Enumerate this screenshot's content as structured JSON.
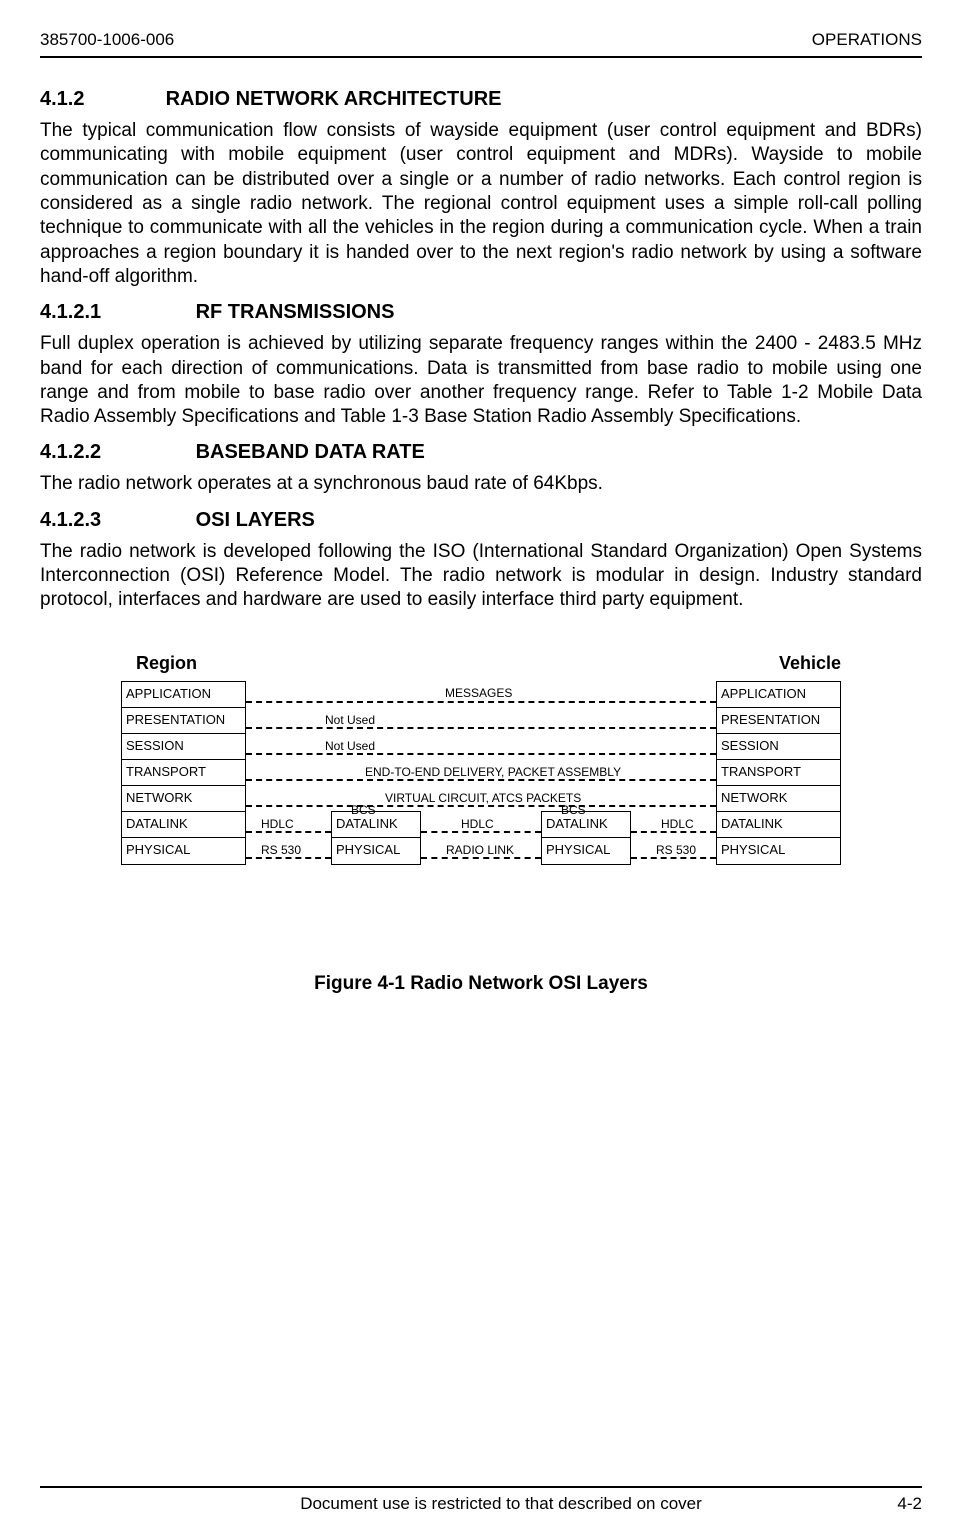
{
  "header": {
    "left": "385700-1006-006",
    "right": "OPERATIONS"
  },
  "sections": {
    "s412": {
      "num": "4.1.2",
      "title": "RADIO NETWORK ARCHITECTURE",
      "para": "The typical communication flow consists of wayside equipment (user  control equipment and BDRs) communicating with mobile equipment  (user control equipment and MDRs).  Wayside to mobile communication can be distributed over a single or a number of radio networks. Each control region is considered as a single radio network. The regional control equipment uses a simple roll-call polling technique to communicate with all the vehicles in the region during a communication cycle. When a train approaches a region boundary it is handed over to the next region's radio network by using a software hand-off algorithm."
    },
    "s4121": {
      "num": "4.1.2.1",
      "title": "RF TRANSMISSIONS",
      "para": "Full duplex operation is achieved by utilizing separate frequency ranges within the 2400 - 2483.5 MHz band for each direction of communications. Data is transmitted from base radio to mobile using one range and from mobile to base radio over another frequency range.  Refer to Table 1-2 Mobile Data Radio Assembly Specifications and Table 1-3 Base Station Radio Assembly Specifications."
    },
    "s4122": {
      "num": "4.1.2.2",
      "title": "BASEBAND DATA RATE",
      "para": "The radio network operates at a synchronous baud rate of 64Kbps."
    },
    "s4123": {
      "num": "4.1.2.3",
      "title": "OSI LAYERS",
      "para": "The radio network is developed following the ISO (International Standard Organization) Open Systems Interconnection (OSI) Reference Model. The radio network is modular in design. Industry standard protocol, interfaces and hardware are used to easily interface third party equipment."
    }
  },
  "chart_data": {
    "type": "diagram",
    "title": "Figure 4-1  Radio Network OSI Layers",
    "region_label": "Region",
    "vehicle_label": "Vehicle",
    "osi_layers": [
      "APPLICATION",
      "PRESENTATION",
      "SESSION",
      "TRANSPORT",
      "NETWORK",
      "DATALINK",
      "PHYSICAL"
    ],
    "mid_stack_layers": [
      "DATALINK",
      "PHYSICAL"
    ],
    "connections": {
      "application": "MESSAGES",
      "presentation": "Not Used",
      "session": "Not Used",
      "transport": "END-TO-END DELIVERY, PACKET ASSEMBLY",
      "network": "VIRTUAL CIRCUIT, ATCS PACKETS",
      "bcs_left": "BCS",
      "bcs_right": "BCS",
      "hdlc_left": "HDLC",
      "hdlc_mid": "HDLC",
      "hdlc_right": "HDLC",
      "rs530_left": "RS 530",
      "rs530_right": "RS 530",
      "radiolink": "RADIO LINK"
    }
  },
  "footer": {
    "center": "Document use is restricted to that described on cover",
    "right": "4-2"
  }
}
